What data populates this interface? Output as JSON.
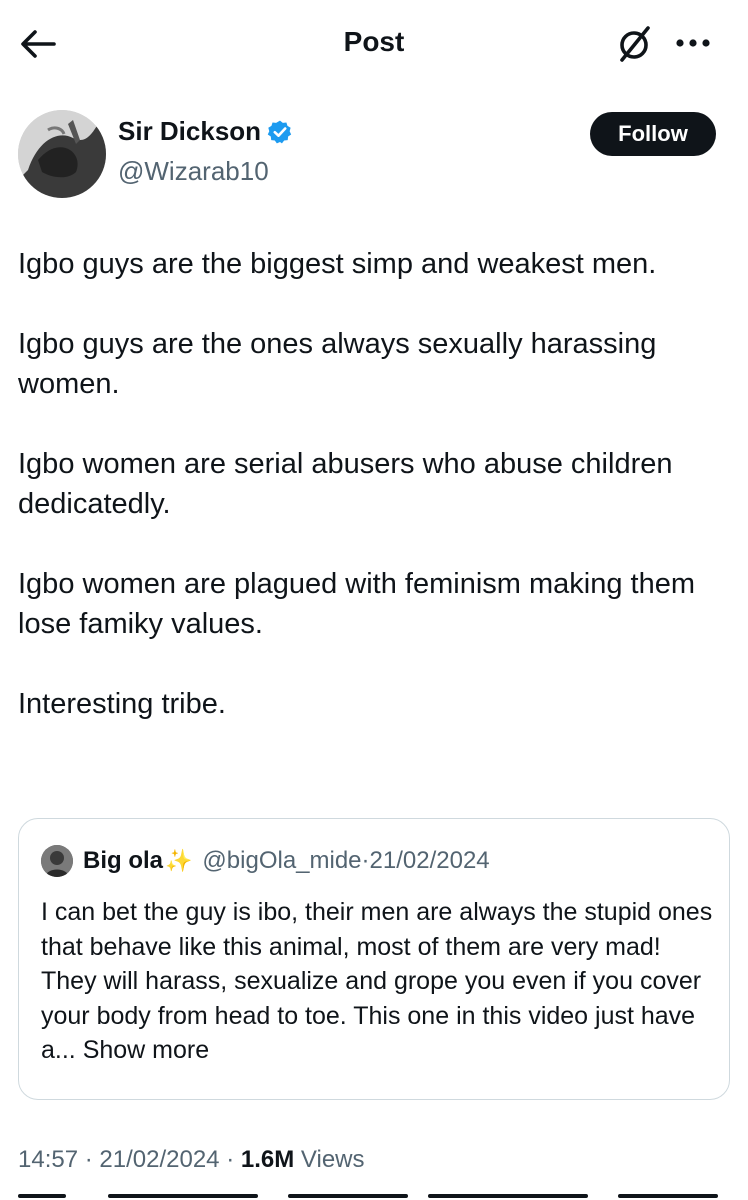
{
  "header": {
    "title": "Post",
    "back_icon": "arrow-left-icon",
    "grok_icon": "grok-icon",
    "more_icon": "more-horizontal-icon"
  },
  "author": {
    "name": "Sir Dickson",
    "handle": "@Wizarab10",
    "verified": true,
    "follow_label": "Follow"
  },
  "post": {
    "paragraphs": [
      "Igbo guys are the biggest simp and weakest men.",
      "Igbo guys are the ones always sexually harassing women.",
      "Igbo women are serial abusers who abuse children dedicatedly.",
      "Igbo women are plagued with feminism making them lose famiky values.",
      "Interesting tribe."
    ]
  },
  "quote": {
    "name": "Big ola",
    "sparkle": "✨",
    "handle": "@bigOla_mide",
    "separator": "·",
    "date": "21/02/2024",
    "text": "I can bet the guy is ibo, their men are always the stupid ones that behave like this animal, most of them are very mad! They will harass, sexualize and grope you even if you cover your body from head to toe. This one in this video just have a...",
    "show_more": "Show more"
  },
  "meta": {
    "time": "14:57",
    "sep1": "·",
    "date": "21/02/2024",
    "sep2": "·",
    "views_count": "1.6M",
    "views_label": "Views"
  },
  "colors": {
    "text": "#0f1419",
    "secondary": "#536471",
    "verified": "#1d9bf0",
    "border": "#cfd9de",
    "button_bg": "#0f1419"
  }
}
